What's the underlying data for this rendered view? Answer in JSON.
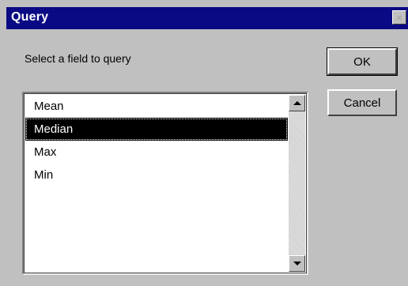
{
  "window": {
    "title": "Query",
    "close_glyph": "×"
  },
  "prompt": "Select a field to query",
  "list": {
    "items": [
      "Mean",
      "Median",
      "Max",
      "Min"
    ],
    "selected": "Median"
  },
  "buttons": {
    "ok_label": "OK",
    "cancel_label": "Cancel"
  },
  "colors": {
    "titlebar": "#0a0a84",
    "face": "#c0c0c0",
    "selection": "#000000"
  }
}
